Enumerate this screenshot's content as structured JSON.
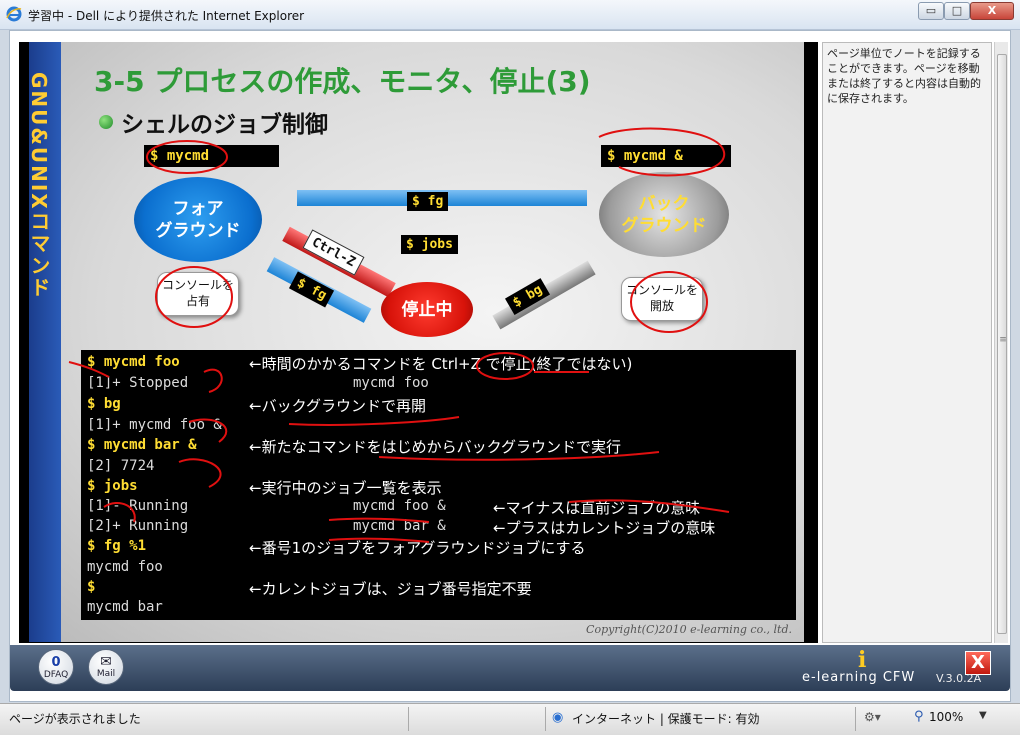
{
  "window": {
    "title": "学習中 - Dell により提供された Internet Explorer",
    "minimize_glyph": "▭",
    "maximize_glyph": "□",
    "close_glyph": "X"
  },
  "slide": {
    "sidebar_text": "GNU&UNIXコマンド",
    "title": "3-5 プロセスの作成、モニタ、停止(3)",
    "subtitle": "シェルのジョブ制御",
    "cmd_foreground": "$ mycmd",
    "cmd_background": "$ mycmd &",
    "cloud_foreground": [
      "フォア",
      "グラウンド"
    ],
    "cloud_background": [
      "バック",
      "グラウンド"
    ],
    "cloud_stopped": "停止中",
    "note_foreground": [
      "コンソールを",
      "占有"
    ],
    "note_background": [
      "コンソールを",
      "開放"
    ],
    "tag_fg_top": "$ fg",
    "tag_jobs": "$ jobs",
    "tag_ctrlz": "Ctrl-Z",
    "tag_fg_low": "$ fg",
    "tag_bg": "$ bg",
    "copyright": "Copyright(C)2010 e-learning co., ltd."
  },
  "terminal": {
    "lines": [
      {
        "text": "$ mycmd foo",
        "style": "ty"
      },
      {
        "text": "[1]+  Stopped",
        "style": "tw"
      },
      {
        "text": "mycmd foo",
        "style": "tw"
      },
      {
        "text": "$ bg",
        "style": "ty"
      },
      {
        "text": "[1]+ mycmd foo &",
        "style": "tw"
      },
      {
        "text": "$ mycmd bar &",
        "style": "ty"
      },
      {
        "text": "[2] 7724",
        "style": "tw"
      },
      {
        "text": "$ jobs",
        "style": "ty"
      },
      {
        "text": "[1]-  Running",
        "style": "tw"
      },
      {
        "text": "mycmd foo &",
        "style": "tw"
      },
      {
        "text": "[2]+  Running",
        "style": "tw"
      },
      {
        "text": "mycmd bar &",
        "style": "tw"
      },
      {
        "text": "$ fg %1",
        "style": "ty"
      },
      {
        "text": "mycmd foo",
        "style": "tw"
      },
      {
        "text": "$",
        "style": "ty"
      },
      {
        "text": "mycmd bar",
        "style": "tw"
      }
    ],
    "explanations": [
      "←時間のかかるコマンドを Ctrl+Z で停止(終了ではない)",
      "←バックグラウンドで再開",
      "←新たなコマンドをはじめからバックグラウンドで実行",
      "←実行中のジョブ一覧を表示",
      "←マイナスは直前ジョブの意味",
      "←プラスはカレントジョブの意味",
      "←番号1のジョブをフォアグラウンドジョブにする",
      "←カレントジョブは、ジョブ番号指定不要"
    ]
  },
  "notes_panel": {
    "text": "ページ単位でノートを記録することができます。ページを移動または終了すると内容は自動的に保存されます。"
  },
  "bottom_bar": {
    "dfaq_count": "0",
    "dfaq_label": "DFAQ",
    "mail_label": "Mail",
    "mail_icon": "✉",
    "brand": "e-learning CFW",
    "info_icon": "i",
    "exit_label": "X",
    "version": "V.3.0.2A"
  },
  "status_bar": {
    "text": "ページが表示されました",
    "zone": "インターネット | 保護モード: 有効",
    "zoom": "100%",
    "zone_icon": "globe-icon",
    "zoom_icon": "magnifier-icon"
  },
  "colors": {
    "slide_title": "#2e9b38",
    "terminal_command": "#ffdd33",
    "pen": "#e01010"
  }
}
